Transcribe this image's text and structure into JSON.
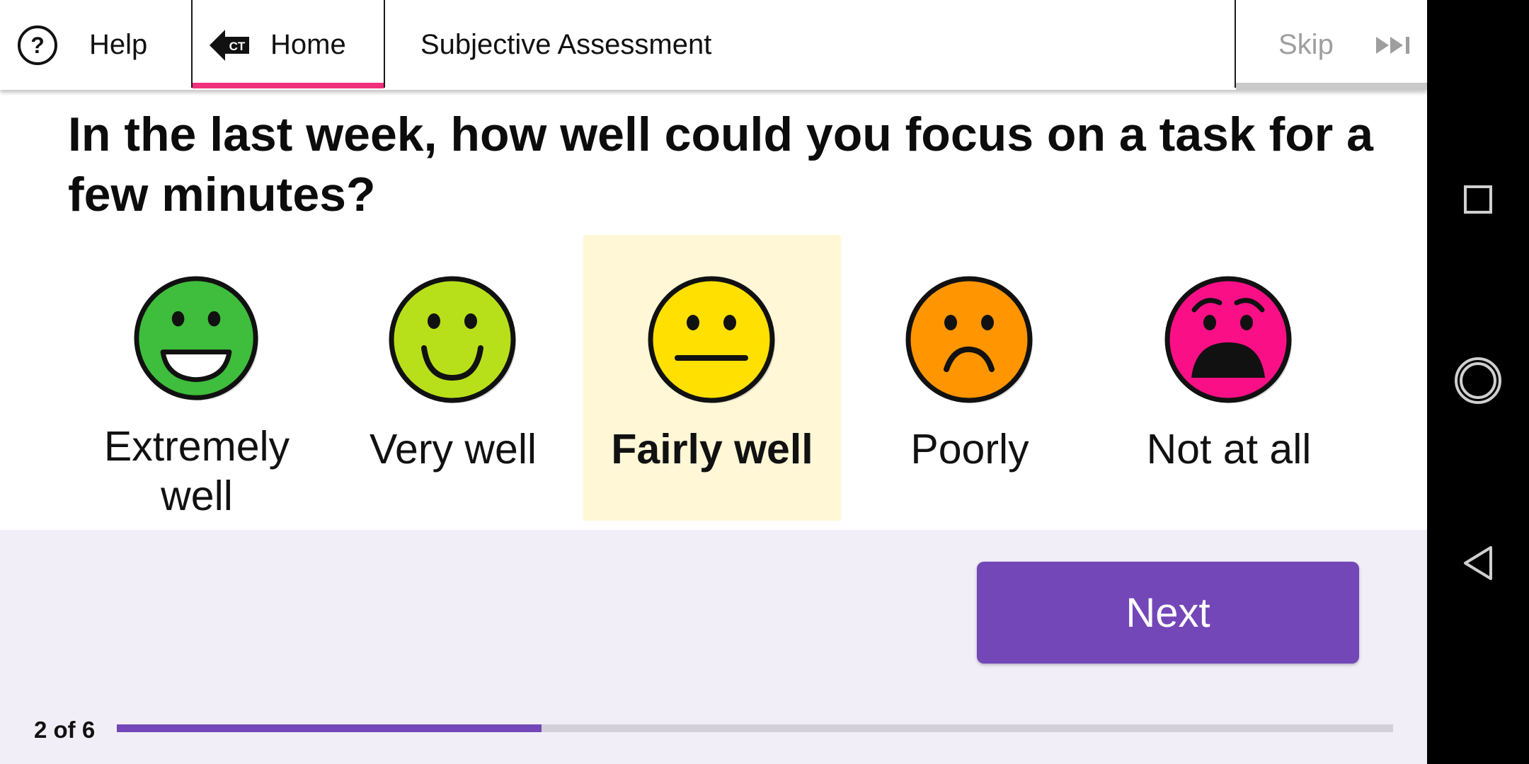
{
  "topbar": {
    "help_label": "Help",
    "help_icon": "help-circle-icon",
    "home_label": "Home",
    "home_icon": "back-arrow-ct-icon",
    "home_icon_text": "CT",
    "title": "Subjective Assessment",
    "skip_label": "Skip",
    "skip_icon": "skip-forward-icon"
  },
  "question": "In the last week, how well could you focus on a task for a few minutes?",
  "options": [
    {
      "label": "Extremely well",
      "icon": "big-grin-face-icon",
      "color": "#3fbd3c",
      "selected": false
    },
    {
      "label": "Very well",
      "icon": "smile-face-icon",
      "color": "#b8e01a",
      "selected": false
    },
    {
      "label": "Fairly well",
      "icon": "neutral-face-icon",
      "color": "#ffe000",
      "selected": true
    },
    {
      "label": "Poorly",
      "icon": "frown-face-icon",
      "color": "#ff9500",
      "selected": false
    },
    {
      "label": "Not at all",
      "icon": "distressed-face-icon",
      "color": "#fb0f86",
      "selected": false
    }
  ],
  "footer": {
    "next_label": "Next",
    "progress_text": "2 of 6",
    "progress_fraction": 0.333
  },
  "colors": {
    "accent": "#7447b8",
    "home_underline": "#f0307d",
    "selected_bg": "#fff7d6",
    "footer_bg": "#f1eef8"
  },
  "navbar": {
    "recents_icon": "square-recents-icon",
    "home_icon": "circle-home-icon",
    "back_icon": "triangle-back-icon"
  }
}
